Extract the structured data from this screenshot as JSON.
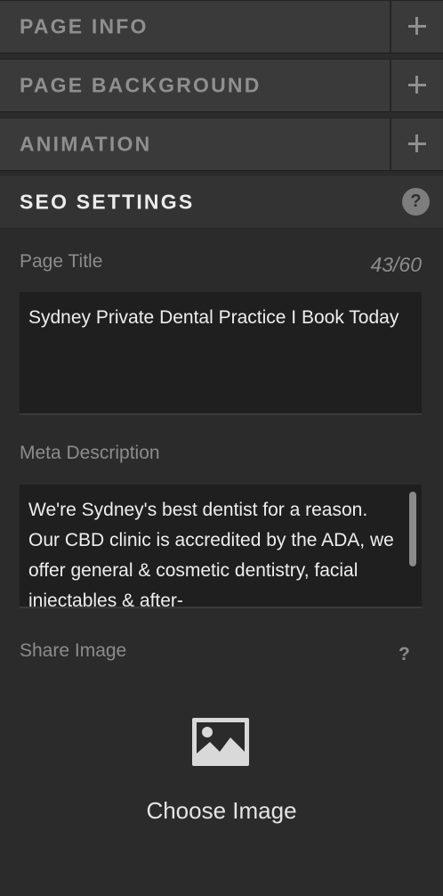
{
  "sections": {
    "page_info": "PAGE INFO",
    "page_background": "PAGE BACKGROUND",
    "animation": "ANIMATION",
    "seo_settings": "SEO SETTINGS"
  },
  "icons": {
    "expand": "plus-icon",
    "help": "help-icon",
    "image": "image-icon"
  },
  "seo": {
    "page_title_label": "Page Title",
    "page_title_counter": "43/60",
    "page_title_value": "Sydney Private Dental Practice I Book Today",
    "meta_description_label": "Meta Description",
    "meta_description_value": "We're Sydney's best dentist for a reason. Our CBD clinic is accredited by the ADA, we offer general & cosmetic dentistry, facial injectables & after-",
    "share_image_label": "Share Image",
    "share_image_help": "?",
    "choose_image_label": "Choose Image"
  },
  "help_glyph": "?"
}
